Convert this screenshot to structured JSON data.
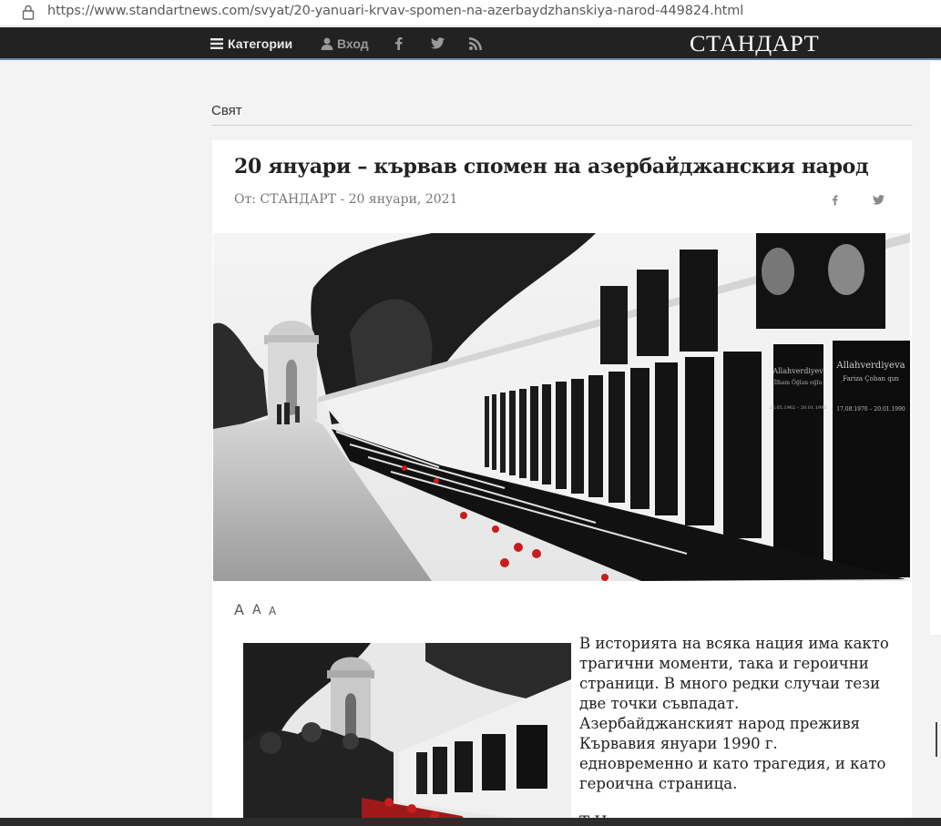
{
  "browser": {
    "url": "https://www.standartnews.com/svyat/20-yanuari-krvav-spomen-na-azerbaydzhanskiya-narod-449824.html",
    "icon": "lock-icon"
  },
  "nav": {
    "categories_label": "Категории",
    "login_label": "Вход",
    "icons": [
      "menu-icon",
      "user-icon",
      "facebook-icon",
      "twitter-icon",
      "rss-icon"
    ],
    "logo": "СТАНДАРТ",
    "bg_color": "#222222",
    "accent_color": "#6d8ab4"
  },
  "breadcrumb": "Свят",
  "article": {
    "title": "20 януари – кървав спомен на азербайджанския народ",
    "byline": "От: СТАНДАРТ - 20 януари, 2021",
    "font_size_controls": [
      "A",
      "A",
      "A"
    ],
    "hero_names": [
      {
        "surname": "Allahverdiyeva",
        "given": "Fariza Çoban qızı",
        "dates": "17.08.1970 – 20.01.1990"
      },
      {
        "surname": "Allahverdiyev",
        "given": "İlham Öğlan oğlu",
        "dates": "25.05.1962 – 20.01.1990"
      }
    ],
    "paragraph1": "В историята на всяка нация има както трагични моменти, така и героични страници. В много редки случаи тези две точки съвпадат. Азербайджанският народ преживя Кървавия януари 1990 г. едновременно и като трагедия, и като героична страница.",
    "paragraph2_start": "Т                        Н"
  }
}
